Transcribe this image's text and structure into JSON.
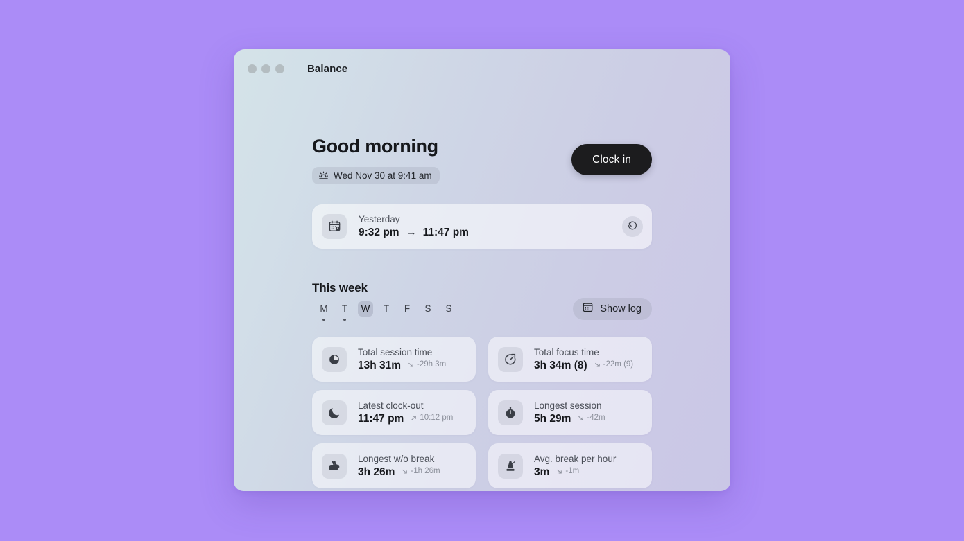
{
  "window": {
    "title": "Balance",
    "traffic_lights": [
      "close",
      "minimize",
      "zoom"
    ]
  },
  "header": {
    "greeting": "Good morning",
    "date_pill": {
      "icon": "sunrise-icon",
      "text": "Wed Nov 30 at 9:41 am"
    },
    "clock_in_label": "Clock in"
  },
  "yesterday": {
    "icon": "calendar-clock-icon",
    "label": "Yesterday",
    "start_time": "9:32 pm",
    "arrow": "→",
    "end_time": "11:47 pm",
    "restore_icon": "undo-rotate-icon"
  },
  "week": {
    "title": "This week",
    "show_log_label": "Show log",
    "show_log_icon": "calendar-grid-icon",
    "days": [
      {
        "letter": "M",
        "selected": false,
        "has_dot": true
      },
      {
        "letter": "T",
        "selected": false,
        "has_dot": true
      },
      {
        "letter": "W",
        "selected": true,
        "has_dot": false
      },
      {
        "letter": "T",
        "selected": false,
        "has_dot": false
      },
      {
        "letter": "F",
        "selected": false,
        "has_dot": false
      },
      {
        "letter": "S",
        "selected": false,
        "has_dot": false
      },
      {
        "letter": "S",
        "selected": false,
        "has_dot": false
      }
    ]
  },
  "stats": [
    {
      "icon": "clock-filled-icon",
      "label": "Total session time",
      "value": "13h 31m",
      "delta": "-29h 3m",
      "delta_direction": "down"
    },
    {
      "icon": "timer-outline-icon",
      "label": "Total focus time",
      "value": "3h 34m (8)",
      "delta": "-22m (9)",
      "delta_direction": "down"
    },
    {
      "icon": "moon-icon",
      "label": "Latest clock-out",
      "value": "11:47 pm",
      "delta": "10:12 pm",
      "delta_direction": "up"
    },
    {
      "icon": "stopwatch-filled-icon",
      "label": "Longest session",
      "value": "5h 29m",
      "delta": "-42m",
      "delta_direction": "down"
    },
    {
      "icon": "rabbit-icon",
      "label": "Longest w/o break",
      "value": "3h 26m",
      "delta": "-1h 26m",
      "delta_direction": "down"
    },
    {
      "icon": "metronome-icon",
      "label": "Avg. break per hour",
      "value": "3m",
      "delta": "-1m",
      "delta_direction": "down"
    }
  ],
  "colors": {
    "page_background": "#ab8cf7",
    "accent_button": "#1c1c1e",
    "window_gradient_start": "#d4e3e8",
    "window_gradient_end": "#cac7e6"
  }
}
